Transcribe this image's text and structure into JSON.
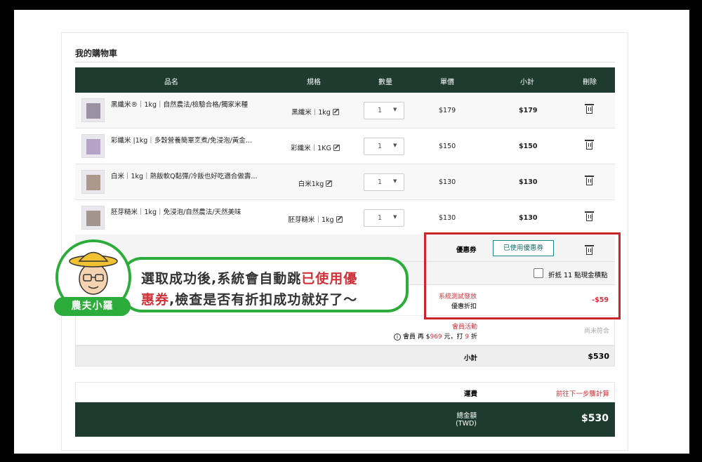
{
  "cart": {
    "title": "我的購物車",
    "headers": {
      "name": "品名",
      "spec": "規格",
      "qty": "數量",
      "price": "單價",
      "subtotal": "小計",
      "delete": "刪除"
    },
    "items": [
      {
        "name": "黑纖米®｜1kg｜自然農法/檢驗合格/獨家米種",
        "spec": "黑纖米｜1kg",
        "qty": "1",
        "price": "$179",
        "subtotal": "$179"
      },
      {
        "name": "彩纖米 |1kg｜多穀營養簡單烹煮/免浸泡/黃金…",
        "spec": "彩纖米｜1KG",
        "qty": "1",
        "price": "$150",
        "subtotal": "$150"
      },
      {
        "name": "白米｜1kg｜熱飯軟Q黏彈/冷飯也好吃適合做壽…",
        "spec": "白米1kg",
        "qty": "1",
        "price": "$130",
        "subtotal": "$130"
      },
      {
        "name": "胚芽糙米｜1kg｜免浸泡/自然農法/天然美味",
        "spec": "胚芽糙米｜1kg",
        "qty": "1",
        "price": "$130",
        "subtotal": "$130"
      }
    ],
    "coupon": {
      "label": "優惠券",
      "button": "已使用優惠券"
    },
    "points": {
      "label": "折抵 11 點現金積點"
    },
    "discount": {
      "source": "系統測試發放",
      "label": "優惠折扣",
      "amount": "-$59"
    },
    "member": {
      "title": "會員活動",
      "prefix": "會員 再 $",
      "amount": "969",
      "mid": " 元，打 ",
      "rate": "9",
      "suffix": " 折",
      "status": "尚未符合"
    },
    "subtotal": {
      "label": "小計",
      "value": "$530"
    },
    "shipping": {
      "label": "運費",
      "value": "前往下一步驟計算"
    },
    "total": {
      "label": "總金額",
      "currency": "(TWD)",
      "value": "$530"
    }
  },
  "callout": {
    "line1": "選取成功後,系統會自動跳",
    "line1_red": "已使用優",
    "line2_red": "惠券",
    "line2": ",檢查是否有折扣成功就好了～",
    "badge": "農夫小羅"
  },
  "colors": {
    "header_bg": "#1e3b30",
    "accent_red": "#d0323a",
    "bubble_green": "#2cad3b",
    "teal": "#1a8a8a"
  }
}
